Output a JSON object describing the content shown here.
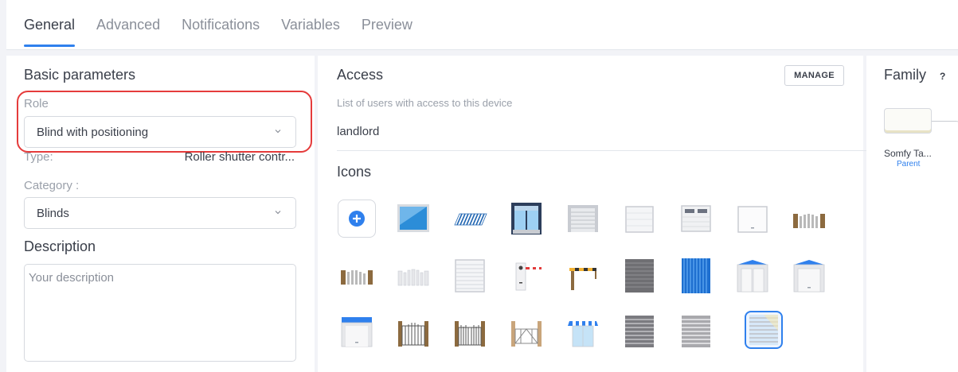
{
  "tabs": [
    {
      "label": "General",
      "active": true
    },
    {
      "label": "Advanced",
      "active": false
    },
    {
      "label": "Notifications",
      "active": false
    },
    {
      "label": "Variables",
      "active": false
    },
    {
      "label": "Preview",
      "active": false
    }
  ],
  "basic": {
    "title": "Basic parameters",
    "role_label": "Role",
    "role_value": "Blind with positioning",
    "type_label": "Type:",
    "type_value": "Roller shutter contr...",
    "category_label": "Category :",
    "category_value": "Blinds",
    "description_title": "Description",
    "description_placeholder": "Your description"
  },
  "access": {
    "title": "Access",
    "manage_label": "MANAGE",
    "subtitle": "List of users with access to this device",
    "users": [
      "landlord"
    ]
  },
  "icons": {
    "title": "Icons",
    "items": [
      "add-icon",
      "window-icon",
      "awning-icon",
      "open-shutter-window-icon",
      "garage-door-icon",
      "shutter-closed-icon",
      "garage-windowed-icon",
      "garage-white-icon",
      "wooden-gate-icon",
      "wooden-fence-icon",
      "white-fence-icon",
      "roller-shutter-icon",
      "barrier-open-icon",
      "barrier-closed-icon",
      "venetian-blind-icon",
      "blue-curtain-icon",
      "garage-double-door-icon",
      "garage-blue-roof-icon",
      "garage-blue-door-icon",
      "gate-icon",
      "double-gate-icon",
      "sliding-gate-icon",
      "shop-awning-icon",
      "dark-blind-icon",
      "light-blind-icon",
      "selected-blind-icon"
    ],
    "selected": "selected-blind-icon"
  },
  "family": {
    "title": "Family",
    "help": "?",
    "device_name": "Somfy Ta...",
    "device_role": "Parent"
  },
  "colors": {
    "accent": "#2f80ed",
    "highlight": "#e53b3b"
  }
}
